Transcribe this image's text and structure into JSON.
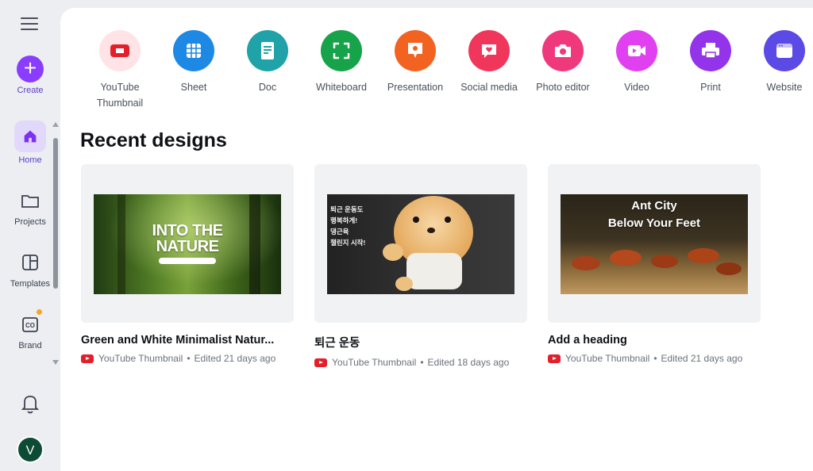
{
  "sidebar": {
    "create_label": "Create",
    "items": [
      {
        "label": "Home",
        "icon": "home-icon"
      },
      {
        "label": "Projects",
        "icon": "folder-icon"
      },
      {
        "label": "Templates",
        "icon": "templates-icon"
      },
      {
        "label": "Brand",
        "icon": "brand-icon"
      }
    ],
    "avatar_initial": "V"
  },
  "design_types": [
    {
      "label": "YouTube\nThumbnail",
      "color": "#ffe3e7",
      "icon": "youtube-thumbnail-icon"
    },
    {
      "label": "Sheet",
      "color": "#1e88e5",
      "icon": "sheet-icon"
    },
    {
      "label": "Doc",
      "color": "#1fa3a8",
      "icon": "doc-icon"
    },
    {
      "label": "Whiteboard",
      "color": "#17a34a",
      "icon": "whiteboard-icon"
    },
    {
      "label": "Presentation",
      "color": "#f26322",
      "icon": "presentation-icon"
    },
    {
      "label": "Social media",
      "color": "#f0365b",
      "icon": "social-media-icon"
    },
    {
      "label": "Photo editor",
      "color": "#f0387d",
      "icon": "photo-editor-icon"
    },
    {
      "label": "Video",
      "color": "#e040f0",
      "icon": "video-icon"
    },
    {
      "label": "Print",
      "color": "#9333ea",
      "icon": "print-icon"
    },
    {
      "label": "Website",
      "color": "#5b4ae6",
      "icon": "website-icon"
    }
  ],
  "recent": {
    "title": "Recent designs",
    "items": [
      {
        "title": "Green and White Minimalist Natur...",
        "type": "YouTube Thumbnail",
        "edited": "Edited 21 days ago",
        "thumb_text": "INTO THE\nNATURE"
      },
      {
        "title": "퇴근 운동",
        "type": "YouTube Thumbnail",
        "edited": "Edited 18 days ago",
        "thumb_text": "퇴근 운동도\n행복하게!\n댕근육\n챌린지 시작!"
      },
      {
        "title": "Add a heading",
        "type": "YouTube Thumbnail",
        "edited": "Edited 21 days ago",
        "thumb_text": "Ant City\nBelow Your Feet"
      }
    ]
  },
  "colors": {
    "accent": "#8b3dff",
    "youtube": "#e3202a"
  }
}
